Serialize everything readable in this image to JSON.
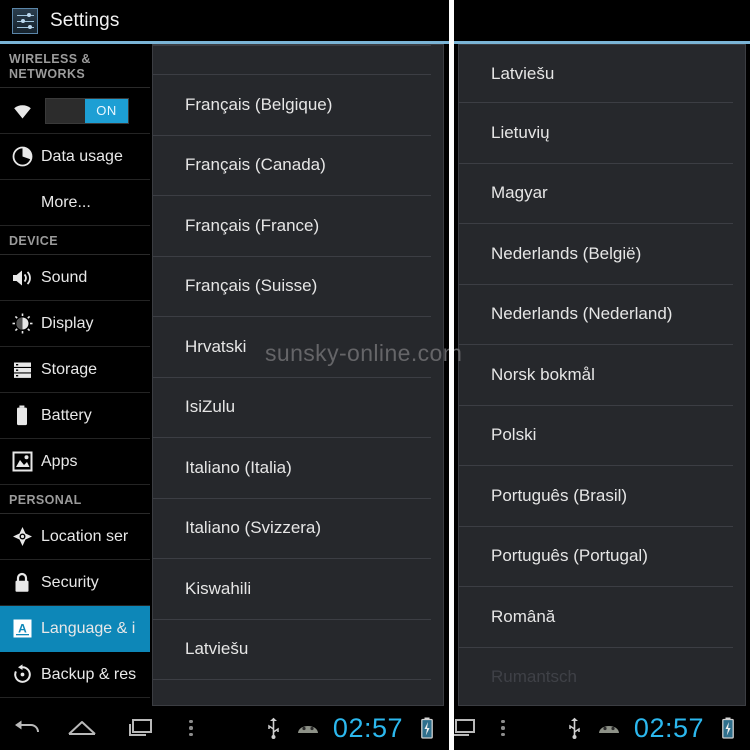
{
  "titlebar": {
    "app_icon": "settings-sliders-icon",
    "title": "Settings"
  },
  "watermark": "sunsky-online.com",
  "sidebar": {
    "sections": [
      {
        "header": "WIRELESS &\nNETWORKS",
        "items": [
          {
            "label": "",
            "icon": "wifi-icon",
            "control": "toggle",
            "toggle_state": "ON"
          },
          {
            "label": "Data usage",
            "icon": "data-usage-icon"
          },
          {
            "label": "More...",
            "icon": "none",
            "indent": true
          }
        ]
      },
      {
        "header": "DEVICE",
        "items": [
          {
            "label": "Sound",
            "icon": "sound-icon"
          },
          {
            "label": "Display",
            "icon": "display-icon"
          },
          {
            "label": "Storage",
            "icon": "storage-icon"
          },
          {
            "label": "Battery",
            "icon": "battery-icon"
          },
          {
            "label": "Apps",
            "icon": "apps-icon"
          }
        ]
      },
      {
        "header": "PERSONAL",
        "items": [
          {
            "label": "Location ser",
            "icon": "location-icon"
          },
          {
            "label": "Security",
            "icon": "lock-icon"
          },
          {
            "label": "Language & i",
            "icon": "language-a-icon",
            "selected": true
          },
          {
            "label": "Backup & res",
            "icon": "backup-restore-icon"
          }
        ]
      }
    ],
    "selected_accent": "#0d87b8"
  },
  "middle_panel": {
    "name": "language-list-scroll-1",
    "clipped_top_item": "",
    "items": [
      "Français (Belgique)",
      "Français (Canada)",
      "Français (France)",
      "Français (Suisse)",
      "Hrvatski",
      "IsiZulu",
      "Italiano (Italia)",
      "Italiano (Svizzera)",
      "Kiswahili",
      "Latviešu"
    ]
  },
  "right_panel": {
    "name": "language-list-scroll-2",
    "items": [
      "Latviešu",
      "Lietuvių",
      "Magyar",
      "Nederlands (België)",
      "Nederlands (Nederland)",
      "Norsk bokmål",
      "Polski",
      "Português (Brasil)",
      "Português (Portugal)",
      "Română"
    ],
    "partial_item": "Rumantsch"
  },
  "navbar_left": {
    "back": "back-icon",
    "home": "home-icon",
    "recents": "recents-icon",
    "menu": "menu-overflow-icon",
    "usb": "usb-icon",
    "android": "android-debug-icon",
    "clock": "02:57",
    "battery": "battery-charging-icon"
  },
  "navbar_right": {
    "recents": "recents-icon",
    "menu": "menu-overflow-icon",
    "usb": "usb-icon",
    "android": "android-debug-icon",
    "clock": "02:57",
    "battery": "battery-charging-icon"
  },
  "colors": {
    "accent_blue": "#0d87b8",
    "clock_blue": "#2cb8ee",
    "rule_blue": "#7ab4d6",
    "panel_bg": "#26282c",
    "window_bg": "#000000"
  }
}
